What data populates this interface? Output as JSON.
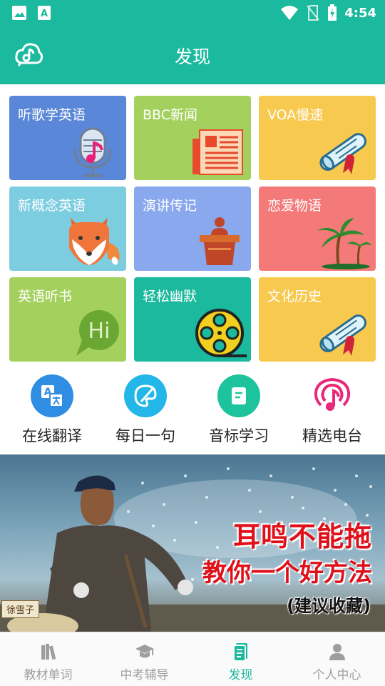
{
  "status": {
    "time": "4:54"
  },
  "header": {
    "title": "发现"
  },
  "tiles": [
    {
      "label": "听歌学英语",
      "color": "#5b87d8",
      "icon": "microphone-music-icon"
    },
    {
      "label": "BBC新闻",
      "color": "#a4d15d",
      "icon": "newspaper-icon"
    },
    {
      "label": "VOA慢速",
      "color": "#f7c94f",
      "icon": "scroll-diploma-icon"
    },
    {
      "label": "新概念英语",
      "color": "#7dcde0",
      "icon": "fox-icon"
    },
    {
      "label": "演讲传记",
      "color": "#8aa8ee",
      "icon": "podium-icon"
    },
    {
      "label": "恋爱物语",
      "color": "#f47a7a",
      "icon": "palm-island-icon"
    },
    {
      "label": "英语听书",
      "color": "#a4d15d",
      "icon": "hi-bubble-icon"
    },
    {
      "label": "轻松幽默",
      "color": "#1bb99d",
      "icon": "film-reel-icon"
    },
    {
      "label": "文化历史",
      "color": "#f7c94f",
      "icon": "scroll-diploma-icon"
    }
  ],
  "quick": [
    {
      "label": "在线翻译",
      "color": "#2f8de4",
      "icon": "translate-icon"
    },
    {
      "label": "每日一句",
      "color": "#23b6e8",
      "icon": "palette-icon"
    },
    {
      "label": "音标学习",
      "color": "#1dc39c",
      "icon": "note-card-icon"
    },
    {
      "label": "精选电台",
      "color": "#e8287a",
      "icon": "podcast-icon"
    }
  ],
  "banner": {
    "line1": "耳鸣不能拖",
    "line2": "教你一个好方法",
    "line3": "(建议收藏)",
    "stamp": "徐雪子"
  },
  "tabs": [
    {
      "label": "教材单词",
      "icon": "books-icon",
      "active": false
    },
    {
      "label": "中考辅导",
      "icon": "graduation-cap-icon",
      "active": false
    },
    {
      "label": "发现",
      "icon": "discover-book-icon",
      "active": true
    },
    {
      "label": "个人中心",
      "icon": "person-icon",
      "active": false
    }
  ],
  "colors": {
    "brand": "#1bb99d",
    "inactive": "#9e9e9e"
  }
}
